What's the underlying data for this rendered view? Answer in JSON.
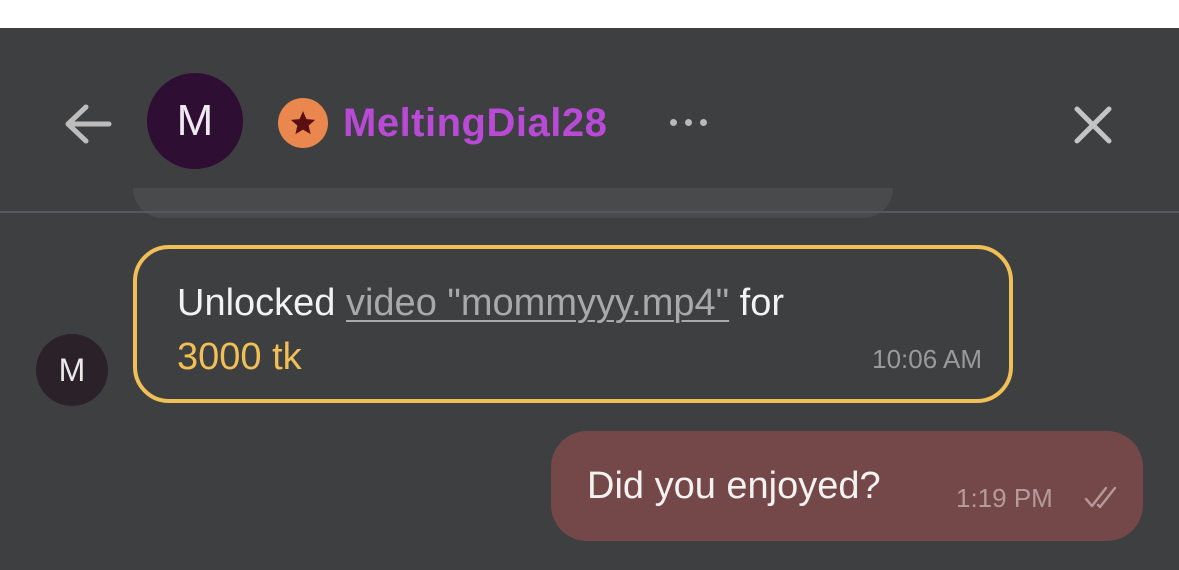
{
  "header": {
    "avatar_letter": "M",
    "username": "MeltingDial28",
    "badge_icon": "star-icon",
    "username_color": "#b84ad6",
    "badge_color": "#e9874e"
  },
  "messages": [
    {
      "direction": "incoming",
      "avatar_letter": "M",
      "text_prefix": "Unlocked ",
      "link_text": "video \"mommyyy.mp4\"",
      "text_suffix": " for",
      "price": "3000 tk",
      "time": "10:06 AM",
      "border_color": "#f0bf56"
    },
    {
      "direction": "outgoing",
      "text": "Did you enjoyed?",
      "time": "1:19 PM",
      "status_icon": "double-check-icon",
      "bubble_color": "#744848"
    }
  ]
}
